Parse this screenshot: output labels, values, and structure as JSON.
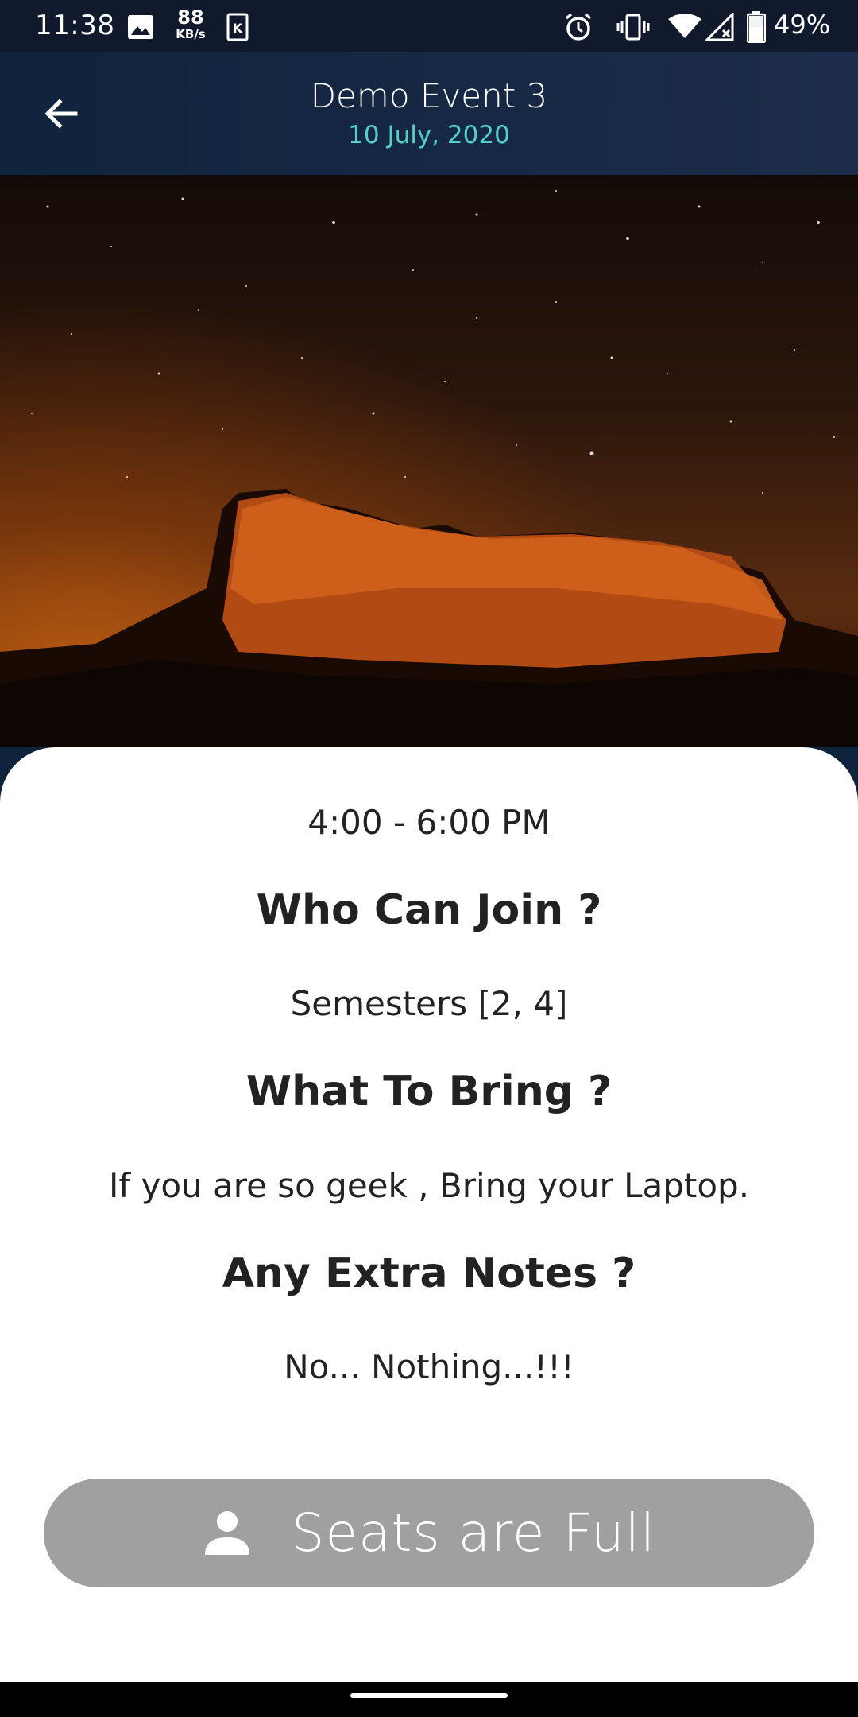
{
  "status_bar": {
    "time": "11:38",
    "net_speed_value": "88",
    "net_speed_unit": "KB/s",
    "battery_percent": "49%",
    "icons": [
      "image-icon",
      "k-app-icon",
      "alarm-icon",
      "vibrate-icon",
      "wifi-icon",
      "signal-icon",
      "battery-icon"
    ]
  },
  "app_bar": {
    "title": "Demo Event 3",
    "date": "10 July, 2020",
    "back_icon": "arrow-left-icon"
  },
  "hero": {
    "icon": "hero-image"
  },
  "event": {
    "time": "4:00 - 6:00 PM",
    "who_heading": "Who Can Join ?",
    "who_text": "Semesters [2, 4]",
    "bring_heading": "What To Bring ?",
    "bring_text": "If you are so geek , Bring your Laptop.",
    "notes_heading": "Any Extra Notes ?",
    "notes_text": "No... Nothing...!!!"
  },
  "action": {
    "label": "Seats are Full",
    "icon": "person-icon"
  },
  "colors": {
    "app_bar": "#10233c",
    "accent": "#4fd1c5",
    "button_disabled": "#a0a0a0",
    "text": "#222222"
  }
}
